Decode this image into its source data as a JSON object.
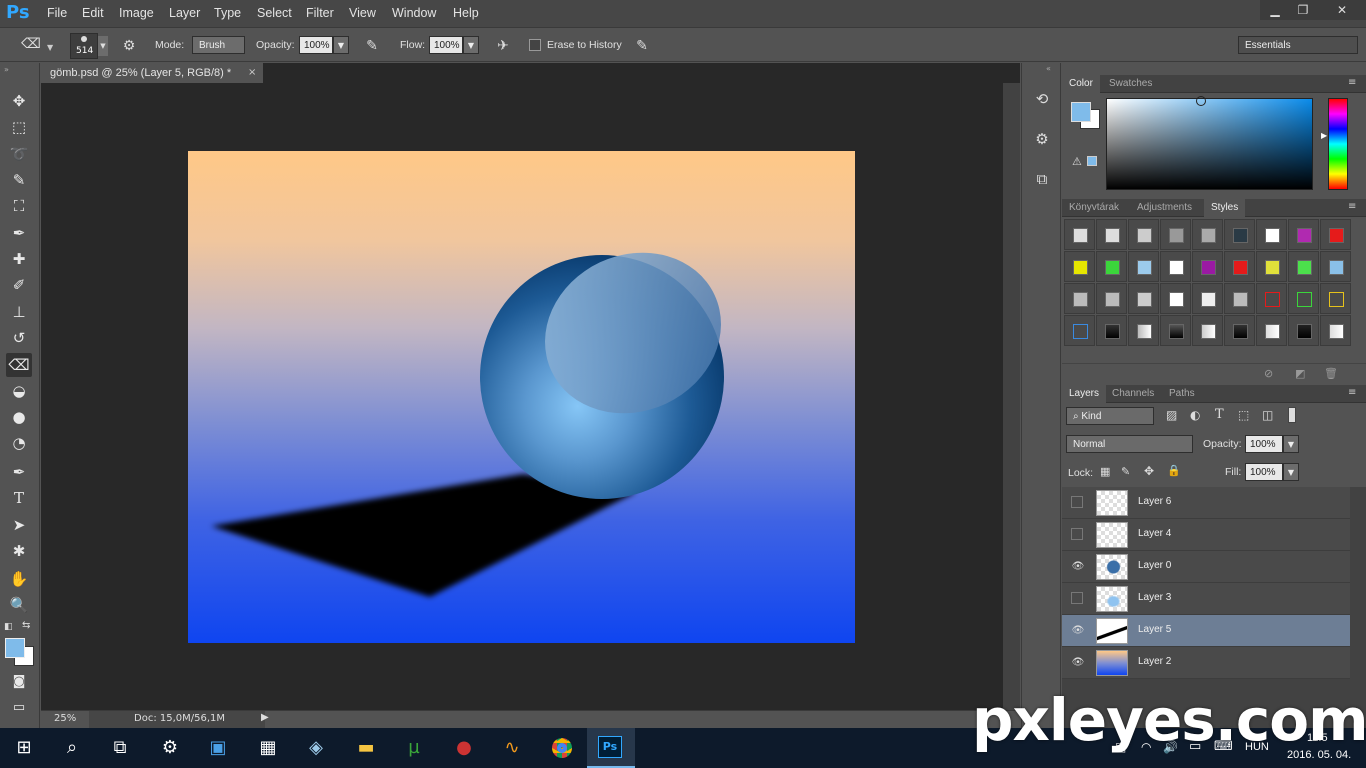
{
  "app": {
    "logo": "Ps",
    "accent": "#31a8ff"
  },
  "menu": [
    "File",
    "Edit",
    "Image",
    "Layer",
    "Type",
    "Select",
    "Filter",
    "View",
    "Window",
    "Help"
  ],
  "window_controls": [
    "minimize",
    "restore",
    "close"
  ],
  "options": {
    "brush_size": "514",
    "mode_label": "Mode:",
    "mode_value": "Brush",
    "opacity_label": "Opacity:",
    "opacity_value": "100%",
    "flow_label": "Flow:",
    "flow_value": "100%",
    "erase_history_label": "Erase to History",
    "workspace": "Essentials"
  },
  "document": {
    "tab_title": "gömb.psd @ 25% (Layer 5, RGB/8) *",
    "close": "×"
  },
  "status": {
    "zoom": "25%",
    "doc_info": "Doc: 15,0M/56,1M"
  },
  "color_panel": {
    "tabs": [
      "Color",
      "Swatches"
    ],
    "foreground": "#7fbbea",
    "background": "#ffffff"
  },
  "styles_panel": {
    "tabs": [
      "Könyvtárak",
      "Adjustments",
      "Styles"
    ]
  },
  "layers_panel": {
    "tabs": [
      "Layers",
      "Channels",
      "Paths"
    ],
    "filter_kind": "Kind",
    "blend_mode": "Normal",
    "opacity_label": "Opacity:",
    "opacity_value": "100%",
    "lock_label": "Lock:",
    "fill_label": "Fill:",
    "fill_value": "100%",
    "layers": [
      {
        "name": "Layer 6",
        "visible": false,
        "selected": false
      },
      {
        "name": "Layer 4",
        "visible": false,
        "selected": false
      },
      {
        "name": "Layer 0",
        "visible": true,
        "selected": false
      },
      {
        "name": "Layer 3",
        "visible": false,
        "selected": false
      },
      {
        "name": "Layer 5",
        "visible": true,
        "selected": true
      },
      {
        "name": "Layer 2",
        "visible": true,
        "selected": false
      }
    ]
  },
  "taskbar": {
    "language": "HUN",
    "date": "2016. 05. 04.",
    "time": "11:5"
  },
  "watermark": "pxleyes.com"
}
